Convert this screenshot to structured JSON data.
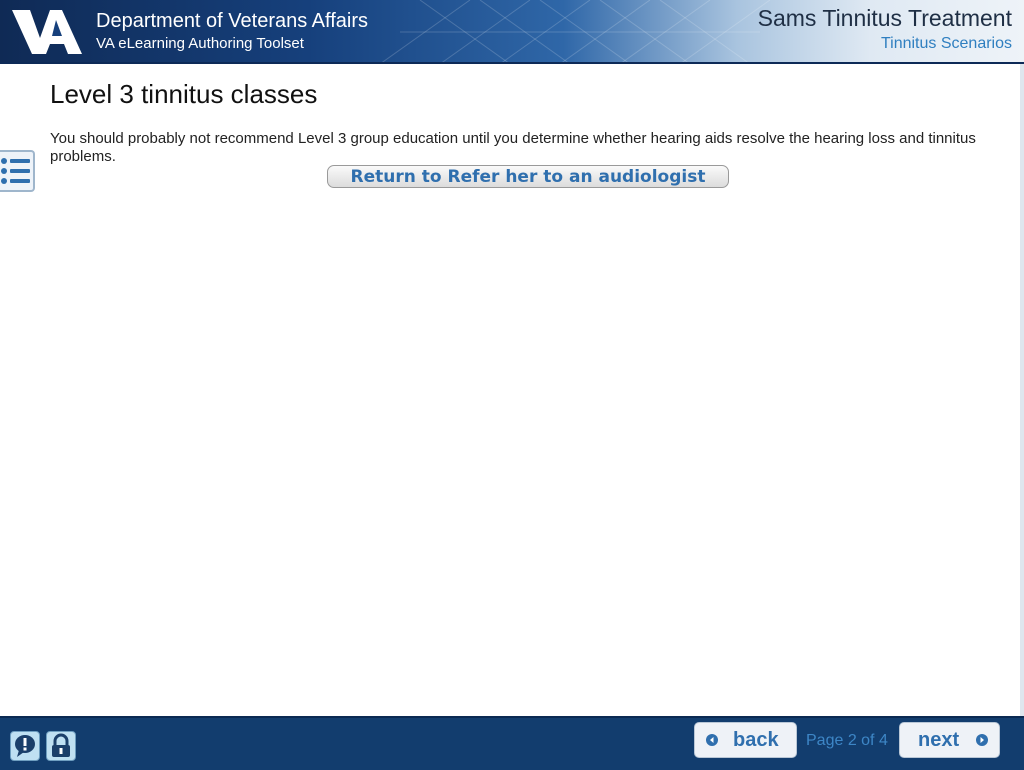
{
  "header": {
    "org_name": "Department of Veterans Affairs",
    "org_sub": "VA eLearning Authoring Toolset",
    "course_title": "Sams Tinnitus Treatment",
    "course_sub": "Tinnitus Scenarios",
    "logo_text": "VA"
  },
  "main": {
    "title": "Level 3 tinnitus classes",
    "body": "You should probably not recommend Level 3 group education until you determine whether hearing aids resolve the hearing loss and tinnitus problems.",
    "return_button": "Return to Refer her to an audiologist"
  },
  "footer": {
    "back_label": "back",
    "next_label": "next",
    "page_indicator": "Page 2 of 4"
  },
  "icons": {
    "menu": "list-icon",
    "help": "help-icon",
    "lock": "lock-icon",
    "back_arrow": "chevron-left-icon",
    "next_arrow": "chevron-right-icon"
  },
  "colors": {
    "header_dark": "#0f2a55",
    "footer_bg": "#123d6e",
    "accent_blue": "#2f6fae",
    "link_blue": "#2f7fc0"
  }
}
